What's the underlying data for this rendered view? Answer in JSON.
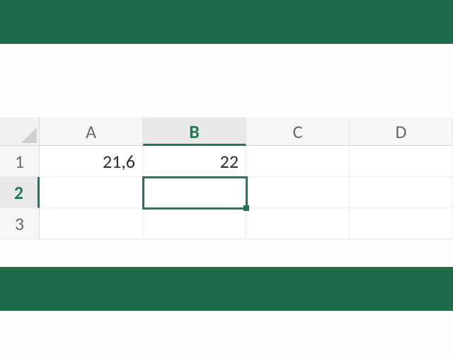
{
  "accent": "#1f6a4a",
  "columns": [
    "A",
    "B",
    "C",
    "D"
  ],
  "rows": [
    "1",
    "2",
    "3"
  ],
  "activeColumnIndex": 1,
  "activeRowIndex": 1,
  "activeCell": "B2",
  "cells": {
    "A1": "21,6",
    "B1": "22",
    "C1": "",
    "D1": "",
    "A2": "",
    "B2": "",
    "C2": "",
    "D2": "",
    "A3": "",
    "B3": "",
    "C3": "",
    "D3": ""
  }
}
